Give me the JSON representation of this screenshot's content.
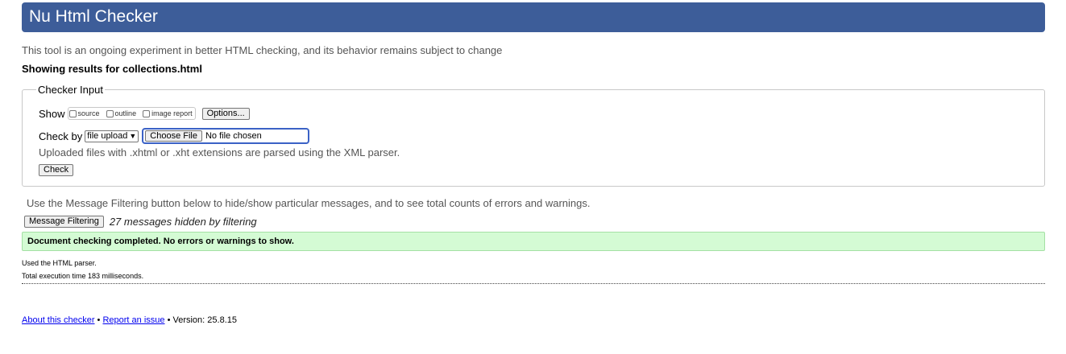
{
  "header": {
    "title": "Nu Html Checker"
  },
  "intro": "This tool is an ongoing experiment in better HTML checking, and its behavior remains subject to change",
  "showing": {
    "prefix": "Showing results for ",
    "filename": "collections.html"
  },
  "checker_input": {
    "legend": "Checker Input",
    "show_label": "Show",
    "show_options": [
      {
        "label": "source",
        "checked": false
      },
      {
        "label": "outline",
        "checked": false
      },
      {
        "label": "image report",
        "checked": false
      }
    ],
    "options_button": "Options...",
    "check_by_label": "Check by",
    "check_by_selected": "file upload",
    "file_button": "Choose File",
    "file_status": "No file chosen",
    "note": "Uploaded files with .xhtml or .xht extensions are parsed using the XML parser.",
    "check_button": "Check"
  },
  "filter": {
    "note": "Use the Message Filtering button below to hide/show particular messages, and to see total counts of errors and warnings.",
    "button": "Message Filtering",
    "hidden_count": "27 messages hidden by filtering"
  },
  "result": {
    "status": "Document checking completed. No errors or warnings to show.",
    "status_color": "#ccffcc",
    "parser": "Used the HTML parser.",
    "execution_time": "Total execution time 183 milliseconds."
  },
  "footer": {
    "about_link": "About this checker",
    "sep1": " • ",
    "report_link": "Report an issue",
    "version": " • Version: 25.8.15"
  },
  "colors": {
    "header_bg": "#3d5d99",
    "focus_ring": "#3b62c6",
    "link": "#0000ee"
  }
}
